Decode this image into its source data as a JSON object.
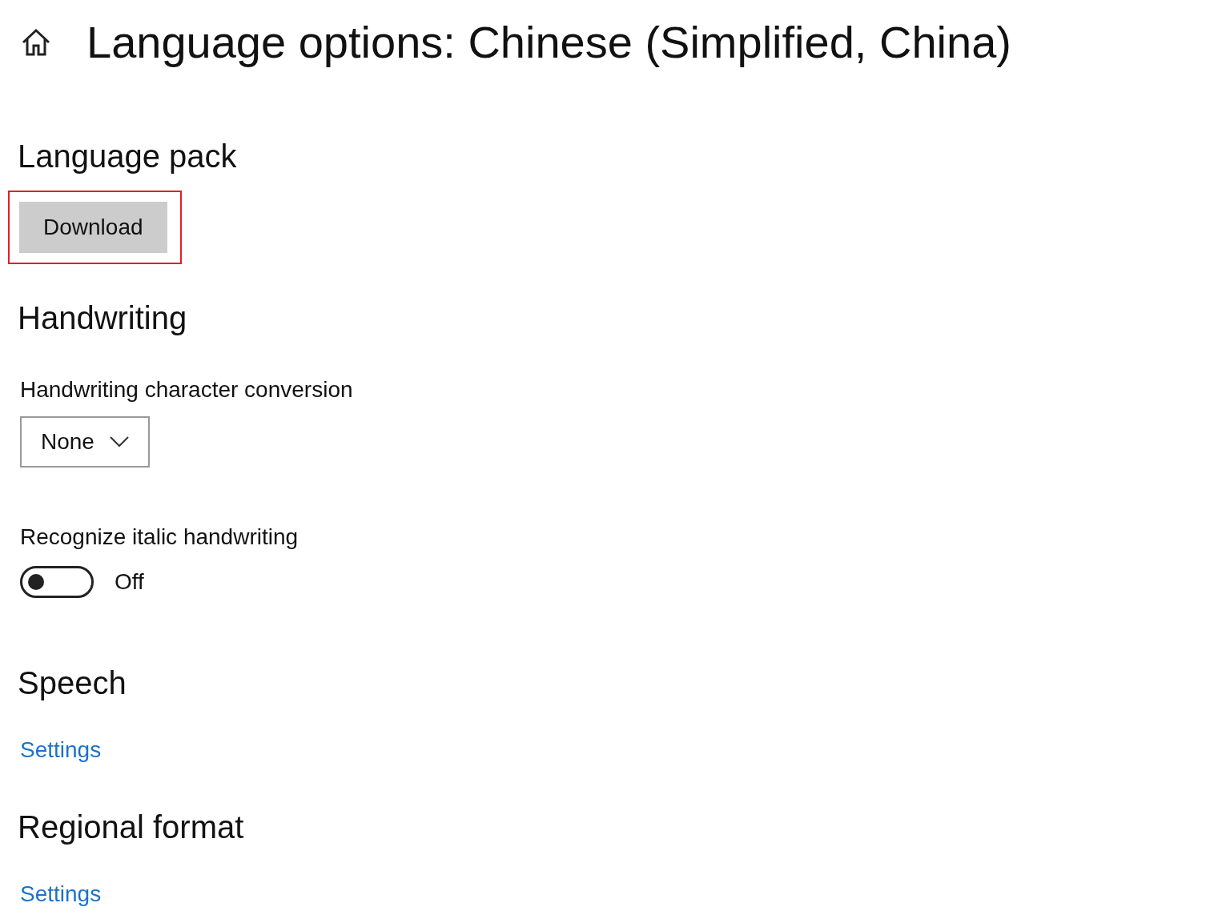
{
  "title": "Language options: Chinese (Simplified, China)",
  "sections": [
    {
      "kind": "button",
      "heading": "Language pack",
      "button": {
        "label": "Download",
        "highlighted": true
      }
    },
    {
      "kind": "handwriting",
      "heading": "Handwriting",
      "conversion": {
        "label": "Handwriting character conversion",
        "value": "None"
      },
      "italic": {
        "label": "Recognize italic handwriting",
        "on": false,
        "state_text": "Off"
      }
    },
    {
      "kind": "link",
      "heading": "Speech",
      "link": "Settings"
    },
    {
      "kind": "link",
      "heading": "Regional format",
      "link": "Settings"
    }
  ]
}
